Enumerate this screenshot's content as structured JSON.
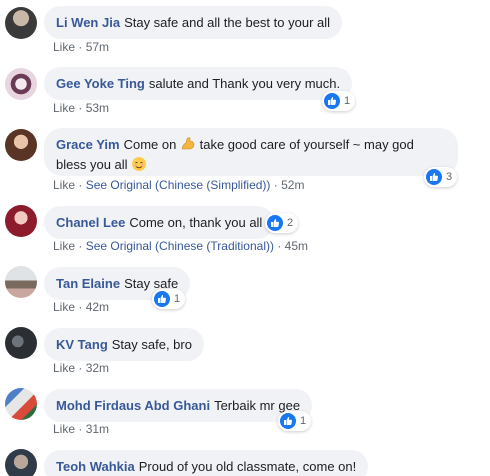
{
  "colors": {
    "bubble_bg": "#f0f2f5",
    "author_blue": "#385898",
    "meta_gray": "#606770",
    "like_blue": "#1877f2"
  },
  "comments": [
    {
      "author": "Li Wen Jia",
      "text": "Stay safe and all the best to your all",
      "like": "Like",
      "time": "57m"
    },
    {
      "author": "Gee Yoke Ting",
      "text": "salute and Thank you very much.",
      "like": "Like",
      "time": "53m",
      "reactions": "1"
    },
    {
      "author": "Grace Yim",
      "text_before": "Come on",
      "emoji1": "flexed-biceps",
      "text_after": "take good care of yourself ~ may god bless you all",
      "emoji2": "relieved-face",
      "like": "Like",
      "see_original": "See Original (Chinese (Simplified))",
      "time": "52m",
      "reactions": "3"
    },
    {
      "author": "Chanel Lee",
      "text": "Come on, thank you all",
      "like": "Like",
      "see_original": "See Original (Chinese (Traditional))",
      "time": "45m",
      "reactions": "2"
    },
    {
      "author": "Tan Elaine",
      "text": "Stay safe",
      "like": "Like",
      "time": "42m",
      "reactions": "1"
    },
    {
      "author": "KV Tang",
      "text": "Stay safe, bro",
      "like": "Like",
      "time": "32m"
    },
    {
      "author": "Mohd Firdaus Abd Ghani",
      "text": "Terbaik mr gee",
      "like": "Like",
      "time": "31m",
      "reactions": "1"
    },
    {
      "author": "Teoh Wahkia",
      "text": "Proud of you old classmate, come on!"
    }
  ]
}
